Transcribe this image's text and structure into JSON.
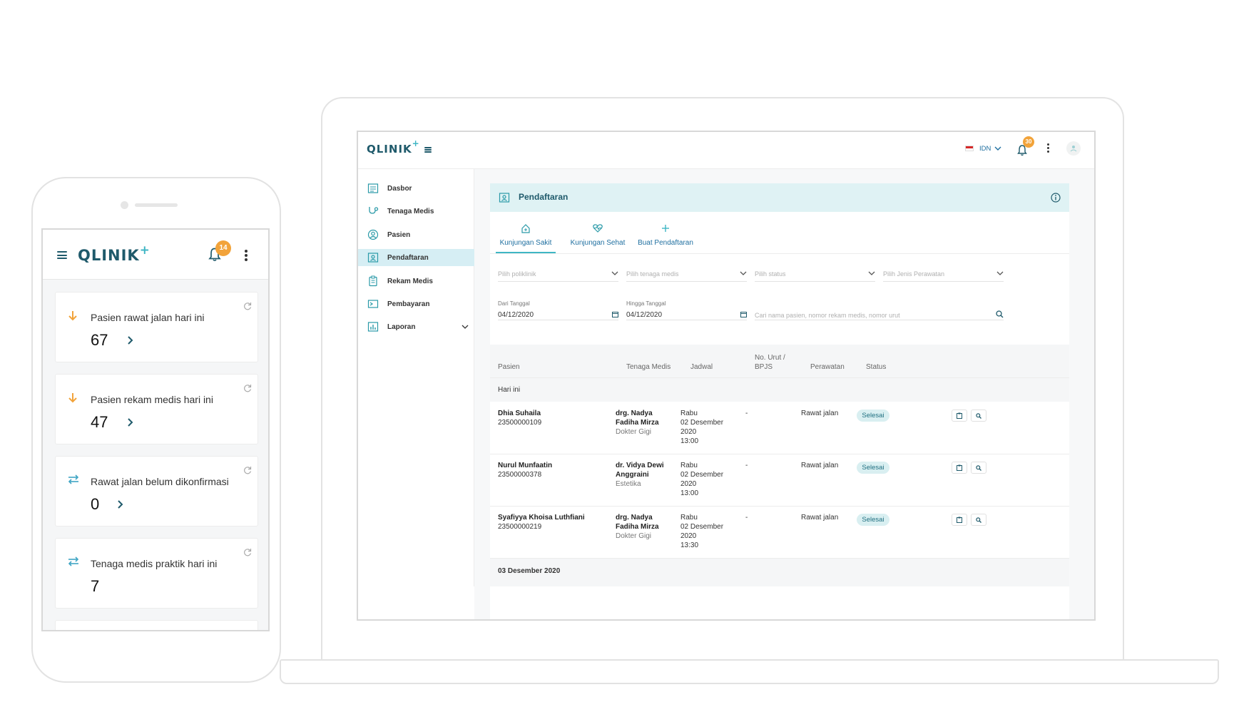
{
  "brand": {
    "name": "QLINIK",
    "plus": "+"
  },
  "desktop": {
    "header": {
      "lang": "IDN",
      "notif_count": "30"
    },
    "sidebar": {
      "items": [
        {
          "label": "Dasbor",
          "icon": "dashboard-icon"
        },
        {
          "label": "Tenaga Medis",
          "icon": "stethoscope-icon"
        },
        {
          "label": "Pasien",
          "icon": "user-icon"
        },
        {
          "label": "Pendaftaran",
          "icon": "registration-icon",
          "active": true
        },
        {
          "label": "Rekam Medis",
          "icon": "clipboard-icon"
        },
        {
          "label": "Pembayaran",
          "icon": "payment-icon"
        },
        {
          "label": "Laporan",
          "icon": "chart-icon",
          "expandable": true
        }
      ]
    },
    "page": {
      "title": "Pendaftaran",
      "tabs": [
        {
          "label": "Kunjungan Sakit",
          "icon": "hospital-icon",
          "active": true
        },
        {
          "label": "Kunjungan Sehat",
          "icon": "heartbeat-icon"
        },
        {
          "label": "Buat Pendaftaran",
          "icon": "plus-icon"
        }
      ],
      "filters": {
        "poliklinik": "Pilih poliklinik",
        "tenaga_medis": "Pilih tenaga medis",
        "status": "Pilih status",
        "jenis_perawatan": "Pilih Jenis Perawatan"
      },
      "dates": {
        "from_label": "Dari Tanggal",
        "from_value": "04/12/2020",
        "to_label": "Hingga Tanggal",
        "to_value": "04/12/2020"
      },
      "search_placeholder": "Cari nama pasien, nomor rekam medis, nomor urut",
      "table": {
        "headers": {
          "pasien": "Pasien",
          "tenaga_medis": "Tenaga Medis",
          "jadwal": "Jadwal",
          "no_urut_1": "No. Urut /",
          "no_urut_2": "BPJS",
          "perawatan": "Perawatan",
          "status": "Status"
        },
        "group_today": "Hari ini",
        "rows": [
          {
            "name": "Dhia Suhaila",
            "id": "23500000109",
            "doctor_1": "drg. Nadya",
            "doctor_2": "Fadiha Mirza",
            "specialty": "Dokter Gigi",
            "day": "Rabu",
            "date": "02 Desember",
            "year": "2020",
            "time": "13:00",
            "no_urut": "-",
            "perawatan": "Rawat jalan",
            "status": "Selesai"
          },
          {
            "name": "Nurul Munfaatin",
            "id": "23500000378",
            "doctor_1": "dr. Vidya Dewi",
            "doctor_2": "Anggraini",
            "specialty": "Estetika",
            "day": "Rabu",
            "date": "02 Desember",
            "year": "2020",
            "time": "13:00",
            "no_urut": "-",
            "perawatan": "Rawat jalan",
            "status": "Selesai"
          },
          {
            "name": "Syafiyya Khoisa Luthfiani",
            "id": "23500000219",
            "doctor_1": "drg. Nadya",
            "doctor_2": "Fadiha Mirza",
            "specialty": "Dokter Gigi",
            "day": "Rabu",
            "date": "02 Desember",
            "year": "2020",
            "time": "13:30",
            "no_urut": "-",
            "perawatan": "Rawat jalan",
            "status": "Selesai"
          }
        ],
        "group_next": "03 Desember 2020"
      }
    }
  },
  "mobile": {
    "notif_count": "14",
    "cards": [
      {
        "label": "Pasien rawat jalan hari ini",
        "value": "67",
        "icon": "arrow-down-icon",
        "has_link": true
      },
      {
        "label": "Pasien rekam medis hari ini",
        "value": "47",
        "icon": "arrow-down-icon",
        "has_link": true
      },
      {
        "label": "Rawat jalan belum dikonfirmasi",
        "value": "0",
        "icon": "transfer-icon",
        "has_link": true
      },
      {
        "label": "Tenaga medis praktik hari ini",
        "value": "7",
        "icon": "transfer-icon",
        "has_link": false
      }
    ]
  },
  "colors": {
    "brand": "#1f5a6b",
    "accent": "#3fb6c4",
    "active_bg": "#d6eef4",
    "badge": "#f2a33a",
    "pill_bg": "#d9eff1"
  }
}
